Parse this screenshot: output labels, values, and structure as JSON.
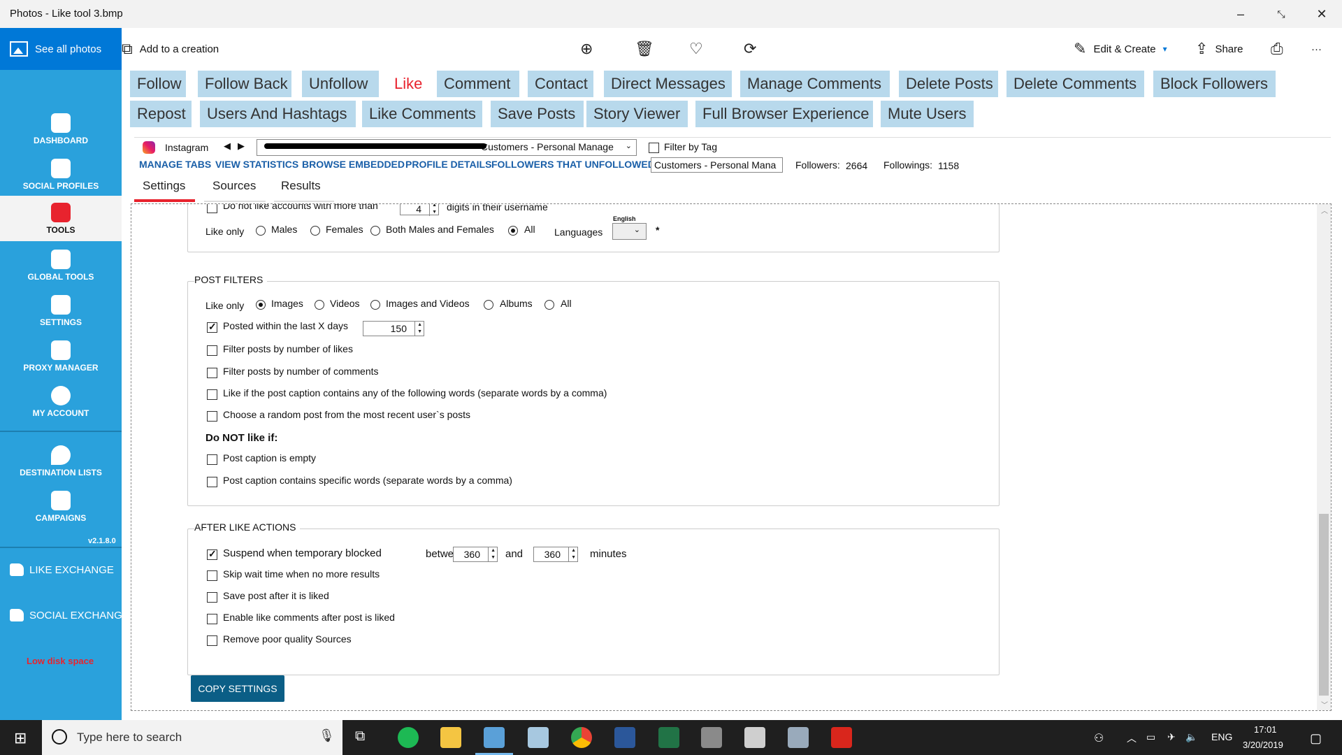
{
  "window": {
    "title": "Photos - Like tool 3.bmp"
  },
  "photos_toolbar": {
    "see_all": "See all photos",
    "add_creation": "Add to a creation",
    "edit_create": "Edit & Create",
    "share": "Share",
    "more": "···"
  },
  "sidebar": {
    "items": [
      "DASHBOARD",
      "SOCIAL PROFILES",
      "TOOLS",
      "GLOBAL TOOLS",
      "SETTINGS",
      "PROXY MANAGER",
      "MY ACCOUNT",
      "DESTINATION LISTS",
      "CAMPAIGNS"
    ],
    "version": "v2.1.8.0",
    "like_exchange": "LIKE EXCHANGE",
    "social_exchange": "SOCIAL EXCHANGE",
    "low_disk": "Low disk space"
  },
  "tabs_row1": [
    "Follow",
    "Follow Back",
    "Unfollow",
    "Like",
    "Comment",
    "Contact",
    "Direct Messages",
    "Manage Comments",
    "Delete Posts",
    "Delete Comments",
    "Block Followers"
  ],
  "tabs_row2": [
    "Repost",
    "Users And Hashtags",
    "Like Comments",
    "Save Posts",
    "Story Viewer",
    "Full Browser Experience",
    "Mute Users"
  ],
  "account": {
    "platform": "Instagram",
    "account_combo": "Customers - Personal Manage",
    "filter_by_tag": "Filter by Tag",
    "links": [
      "MANAGE TABS",
      "VIEW STATISTICS",
      "BROWSE EMBEDDED",
      "PROFILE DETAILS",
      "FOLLOWERS THAT UNFOLLOWED"
    ],
    "list_combo": "Customers - Personal Mana",
    "followers_label": "Followers:",
    "followers": "2664",
    "followings_label": "Followings:",
    "followings": "1158"
  },
  "subtabs": [
    "Settings",
    "Sources",
    "Results"
  ],
  "user_filters": {
    "digits_text_a": "Do not like accounts with more than",
    "digits_value": "4",
    "digits_text_b": "digits in their username",
    "like_only": "Like only",
    "gender_options": [
      "Males",
      "Females",
      "Both Males and Females",
      "All"
    ],
    "languages_label": "Languages",
    "language_value": "English",
    "asterisk": "*"
  },
  "post_filters": {
    "title": "POST FILTERS",
    "like_only": "Like only",
    "type_options": [
      "Images",
      "Videos",
      "Images and Videos",
      "Albums",
      "All"
    ],
    "posted_within": "Posted within the last X days",
    "posted_days": "150",
    "options": [
      "Filter posts by number of likes",
      "Filter posts by number of comments",
      "Like if the post caption contains any of the following words (separate words by a comma)",
      "Choose a random post from the most recent user`s posts"
    ],
    "do_not_like": "Do NOT like if:",
    "do_not_options": [
      "Post caption is empty",
      "Post caption contains specific words (separate words by a comma)"
    ]
  },
  "after_actions": {
    "title": "AFTER LIKE ACTIONS",
    "suspend": "Suspend when temporary blocked",
    "between": "between",
    "from_value": "360",
    "and": "and",
    "to_value": "360",
    "minutes": "minutes",
    "options": [
      "Skip wait time when no more results",
      "Save post after it is liked",
      "Enable like comments after post is liked",
      "Remove poor quality Sources"
    ]
  },
  "copy_settings": "COPY SETTINGS",
  "taskbar": {
    "search_placeholder": "Type here to search",
    "lang": "ENG",
    "time": "17:01",
    "date": "3/20/2019"
  }
}
